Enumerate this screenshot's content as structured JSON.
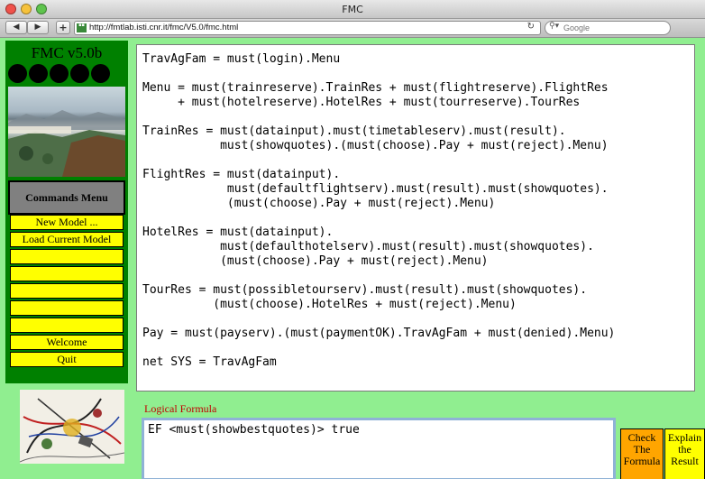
{
  "window": {
    "title": "FMC"
  },
  "toolbar": {
    "back_label": "◀",
    "forward_label": "▶",
    "add_label": "+",
    "url": "http://fmtlab.isti.cnr.it/fmc/V5.0/fmc.html",
    "search_placeholder": "Google"
  },
  "app": {
    "title": "FMC v5.0b"
  },
  "commands": {
    "header": "Commands Menu",
    "items": [
      {
        "label": "New Model ..."
      },
      {
        "label": "Load Current Model"
      },
      {
        "label": ""
      },
      {
        "label": ""
      },
      {
        "label": ""
      },
      {
        "label": ""
      },
      {
        "label": ""
      },
      {
        "label": "Welcome"
      },
      {
        "label": "Quit"
      }
    ]
  },
  "model": {
    "text": "TravAgFam = must(login).Menu\n\nMenu = must(trainreserve).TrainRes + must(flightreserve).FlightRes\n     + must(hotelreserve).HotelRes + must(tourreserve).TourRes\n\nTrainRes = must(datainput).must(timetableserv).must(result).\n           must(showquotes).(must(choose).Pay + must(reject).Menu)\n\nFlightRes = must(datainput).\n            must(defaultflightserv).must(result).must(showquotes).\n            (must(choose).Pay + must(reject).Menu)\n\nHotelRes = must(datainput).\n           must(defaulthotelserv).must(result).must(showquotes).\n           (must(choose).Pay + must(reject).Menu)\n\nTourRes = must(possibletourserv).must(result).must(showquotes).\n          (must(choose).HotelRes + must(reject).Menu)\n\nPay = must(payserv).(must(paymentOK).TravAgFam + must(denied).Menu)\n\nnet SYS = TravAgFam"
  },
  "formula": {
    "label": "Logical Formula",
    "text": "EF <must(showbestquotes)> true"
  },
  "buttons": {
    "check": "Check\nThe\nFormula",
    "explain": "Explain\nthe\nResult"
  },
  "colors": {
    "background": "#90ee90",
    "panel": "#008000",
    "menu_item": "#ffff00",
    "check_button": "#ffa500",
    "formula_label": "#c00000"
  }
}
